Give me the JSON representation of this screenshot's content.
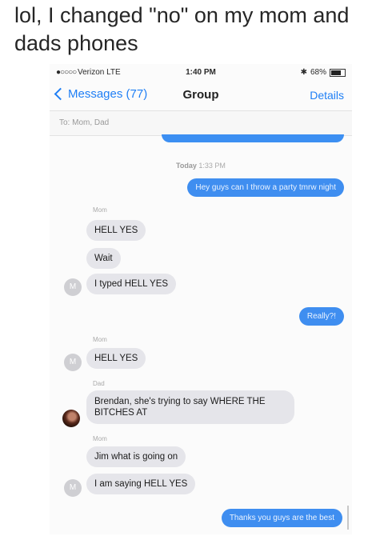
{
  "caption": "lol, I changed \"no\" on my mom and dads phones",
  "status": {
    "carrier": "Verizon  LTE",
    "time": "1:40 PM",
    "battery": "68%"
  },
  "nav": {
    "back_label": "Messages (77)",
    "title": "Group",
    "details_label": "Details"
  },
  "to_line": "To:  Mom, Dad",
  "timestamp": {
    "day": "Today",
    "time": "1:33 PM"
  },
  "messages": [
    {
      "from": "me",
      "text": "Hey guys can I throw a party tmrw night"
    },
    {
      "from": "Mom",
      "text": "HELL YES"
    },
    {
      "from": "Mom",
      "text": "Wait"
    },
    {
      "from": "Mom",
      "text": "I typed HELL YES"
    },
    {
      "from": "me",
      "text": "Really?!"
    },
    {
      "from": "Mom",
      "text": "HELL YES"
    },
    {
      "from": "Dad",
      "text": "Brendan, she's trying to say WHERE THE BITCHES AT"
    },
    {
      "from": "Mom",
      "text": "Jim what is going on"
    },
    {
      "from": "Mom",
      "text": "I am saying HELL YES"
    },
    {
      "from": "me",
      "text": "Thanks you guys are the best"
    }
  ],
  "senders": {
    "mom": "Mom",
    "dad": "Dad"
  },
  "avatar_initial": "M",
  "colors": {
    "sent_bubble": "#3f8ef0",
    "received_bubble": "#e5e5ea",
    "link_blue": "#1f7ff5"
  }
}
